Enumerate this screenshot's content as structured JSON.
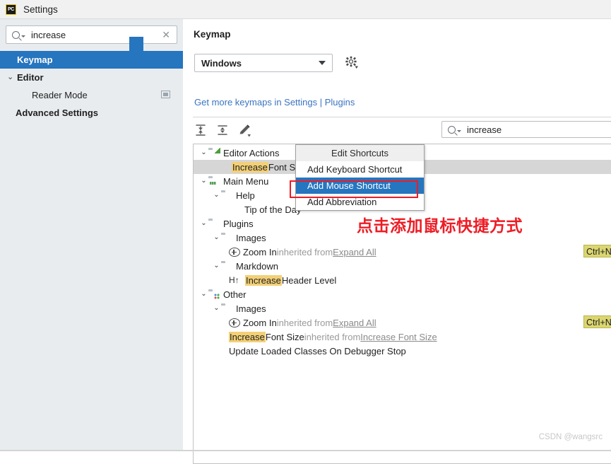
{
  "window": {
    "title": "Settings",
    "app_icon": "pycharm-icon",
    "app_icon_text": "PC"
  },
  "sidebar": {
    "search": {
      "value": "increase",
      "placeholder": "",
      "search_icon": "search-icon",
      "clear_icon": "clear-icon"
    },
    "items": [
      {
        "label": "Keymap",
        "selected": true,
        "indent": 0,
        "chevron": "",
        "bold": true
      },
      {
        "label": "Editor",
        "selected": false,
        "indent": 0,
        "chevron": "⌄",
        "bold": true
      },
      {
        "label": "Reader Mode",
        "selected": false,
        "indent": 1,
        "chevron": "",
        "bold": false,
        "badge": "reader-mode-badge"
      },
      {
        "label": "Advanced Settings",
        "selected": false,
        "indent": 0,
        "chevron": "",
        "bold": true
      }
    ]
  },
  "main": {
    "title": "Keymap",
    "keymap_select": {
      "value": "Windows",
      "caret_icon": "chevron-down-icon"
    },
    "gear_icon": "gear-icon",
    "links": {
      "prefix": "Get more keymaps in ",
      "settings": "Settings",
      "separator": " | ",
      "plugins": "Plugins"
    },
    "toolbar": {
      "expand_all": "expand-all-icon",
      "collapse_all": "collapse-all-icon",
      "edit_shortcut": "edit-pencil-icon"
    },
    "tree_search": {
      "value": "increase",
      "search_icon": "search-icon"
    },
    "tree": [
      {
        "id": "editor-actions",
        "depth": 0,
        "chevron": "⌄",
        "icon": "folder-green-icon",
        "text": "Editor Actions",
        "selected": false
      },
      {
        "id": "increase-font-size",
        "depth": 2,
        "chevron": "",
        "icon": "none",
        "highlight": "Increase",
        "text": " Font Size",
        "selected": true
      },
      {
        "id": "main-menu",
        "depth": 0,
        "chevron": "⌄",
        "icon": "folder-menu-icon",
        "text": "Main Menu",
        "selected": false
      },
      {
        "id": "help",
        "depth": 1,
        "chevron": "⌄",
        "icon": "folder-icon",
        "text": "Help",
        "selected": false
      },
      {
        "id": "tip-of-the-day",
        "depth": 2,
        "chevron": "",
        "icon": "none",
        "text": "Tip of the Day",
        "selected": false
      },
      {
        "id": "plugins",
        "depth": 0,
        "chevron": "⌄",
        "icon": "folder-icon",
        "text": "Plugins",
        "selected": false
      },
      {
        "id": "plugins-images",
        "depth": 1,
        "chevron": "⌄",
        "icon": "folder-icon",
        "text": "Images",
        "selected": false
      },
      {
        "id": "zoom-in-plugins",
        "depth": 2,
        "chevron": "",
        "icon": "plus-circle-icon",
        "text": "Zoom In",
        "dim": " inherited from ",
        "link": "Expand All",
        "shortcut": "Ctrl+Num",
        "selected": false
      },
      {
        "id": "markdown",
        "depth": 1,
        "chevron": "⌄",
        "icon": "folder-icon",
        "text": "Markdown",
        "selected": false
      },
      {
        "id": "increase-header-level",
        "depth": 2,
        "chevron": "",
        "icon": "h-up-icon",
        "icon_text": "H↑",
        "highlight": "Increase",
        "text": " Header Level",
        "selected": false
      },
      {
        "id": "other",
        "depth": 0,
        "chevron": "⌄",
        "icon": "folder-dots-icon",
        "text": "Other",
        "selected": false
      },
      {
        "id": "other-images",
        "depth": 1,
        "chevron": "⌄",
        "icon": "folder-icon",
        "text": "Images",
        "selected": false
      },
      {
        "id": "zoom-in-other",
        "depth": 2,
        "chevron": "",
        "icon": "plus-circle-icon",
        "text": "Zoom In",
        "dim": " inherited from ",
        "link": "Expand All",
        "shortcut": "Ctrl+Num",
        "selected": false
      },
      {
        "id": "increase-font-size-other",
        "depth": 2,
        "chevron": "",
        "icon": "none",
        "highlight": "Increase",
        "text": " Font Size",
        "dim": " inherited from ",
        "link": "Increase Font Size",
        "selected": false
      },
      {
        "id": "update-loaded-classes",
        "depth": 2,
        "chevron": "",
        "icon": "none",
        "text": "Update Loaded Classes On Debugger Stop",
        "selected": false
      }
    ]
  },
  "context_menu": {
    "header": "Edit Shortcuts",
    "items": [
      {
        "label": "Add Keyboard Shortcut",
        "active": false
      },
      {
        "label": "Add Mouse Shortcut",
        "active": true
      },
      {
        "label": "Add Abbreviation",
        "active": false
      }
    ],
    "highlight_color": "#ee1c25",
    "selection_color": "#2675bf"
  },
  "annotation": {
    "text": "点击添加鼠标快捷方式",
    "color": "#ee1c25"
  },
  "watermark": {
    "text": "CSDN @wangsrc"
  }
}
